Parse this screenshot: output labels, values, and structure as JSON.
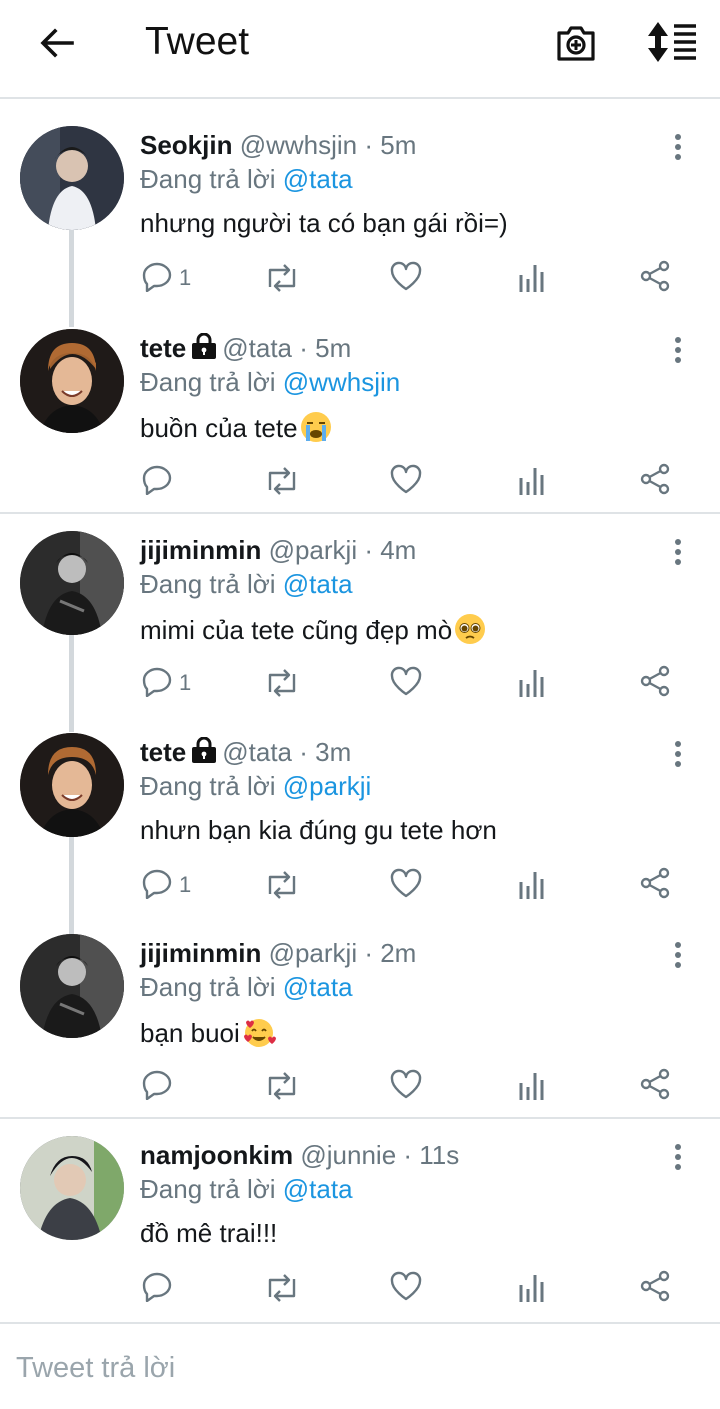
{
  "header": {
    "title": "Tweet"
  },
  "tweets": [
    {
      "name": "Seokjin",
      "locked": false,
      "handle": "@wwhsjin · 5m",
      "reply_prefix": "Đang trả lời ",
      "reply_to": "@tata",
      "text": "nhưng người ta có bạn gái rồi=)",
      "emoji": "",
      "reply_count": "1",
      "avatar_bg": "#3a4150"
    },
    {
      "name": "tete",
      "locked": true,
      "handle": "@tata · 5m",
      "reply_prefix": "Đang trả lời ",
      "reply_to": "@wwhsjin",
      "text": "buồn của tete",
      "emoji": "loudly-crying-face",
      "reply_count": "",
      "avatar_bg": "#2a2320"
    },
    {
      "name": "jijiminmin",
      "locked": false,
      "handle": "@parkji · 4m",
      "reply_prefix": "Đang trả lời ",
      "reply_to": "@tata",
      "text": "mimi của tete cũng đẹp mò",
      "emoji": "pleading-face",
      "reply_count": "1",
      "avatar_bg": "#3b3b3b"
    },
    {
      "name": "tete",
      "locked": true,
      "handle": "@tata · 3m",
      "reply_prefix": "Đang trả lời ",
      "reply_to": "@parkji",
      "text": "nhưn bạn kia đúng gu tete hơn",
      "emoji": "",
      "reply_count": "1",
      "avatar_bg": "#2a2320"
    },
    {
      "name": "jijiminmin",
      "locked": false,
      "handle": "@parkji · 2m",
      "reply_prefix": "Đang trả lời ",
      "reply_to": "@tata",
      "text": "bạn buoi",
      "emoji": "smiling-face-with-hearts",
      "reply_count": "",
      "avatar_bg": "#3b3b3b"
    },
    {
      "name": "namjoonkim",
      "locked": false,
      "handle": "@junnie · 11s",
      "reply_prefix": "Đang trả lời ",
      "reply_to": "@tata",
      "text": "đồ mê trai!!!",
      "emoji": "",
      "reply_count": "",
      "avatar_bg": "#4a4f58"
    }
  ],
  "compose": {
    "placeholder": "Tweet trả lời"
  },
  "colors": {
    "accent": "#1b95e0",
    "secondary_text": "#68767f",
    "divider": "#dfe3e6",
    "thread_line": "#d3d8dc"
  }
}
